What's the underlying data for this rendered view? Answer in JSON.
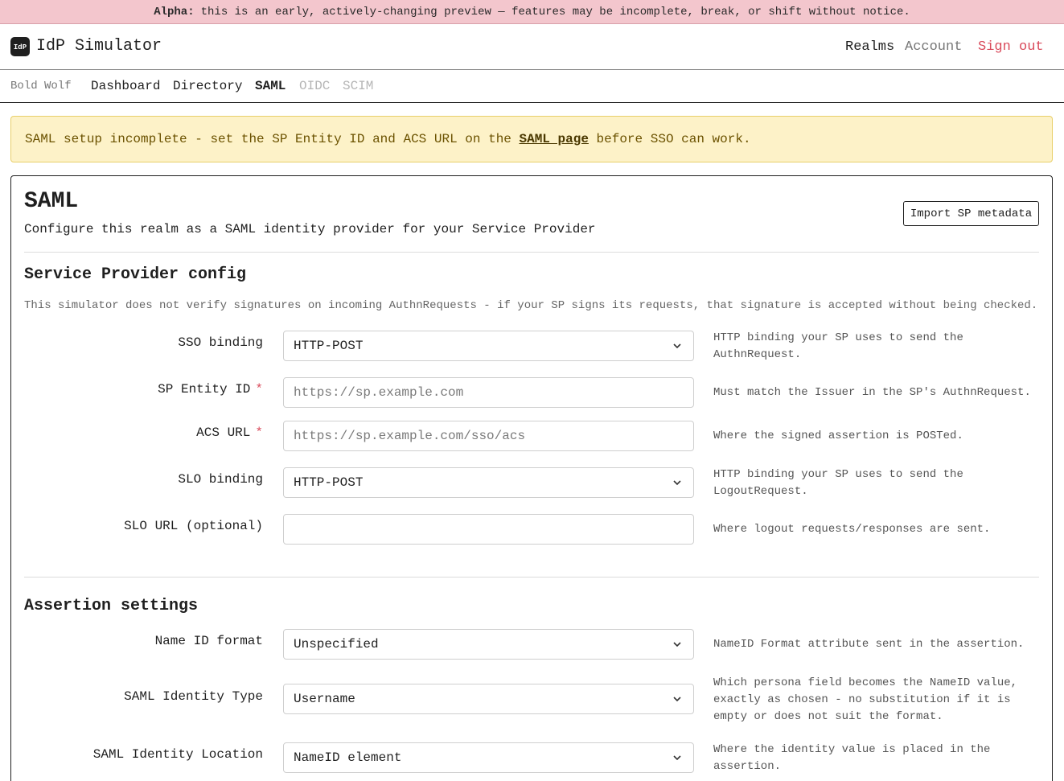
{
  "banner": {
    "strong": "Alpha:",
    "text": "this is an early, actively-changing preview — features may be incomplete, break, or shift without notice."
  },
  "header": {
    "logo_text": "IdP",
    "title": "IdP Simulator",
    "nav": {
      "realms": "Realms",
      "account": "Account",
      "sign_out": "Sign out"
    }
  },
  "subnav": {
    "realm_name": "Bold Wolf",
    "tabs": {
      "dashboard": "Dashboard",
      "directory": "Directory",
      "saml": "SAML",
      "oidc": "OIDC",
      "scim": "SCIM"
    }
  },
  "warning": {
    "before": "SAML setup incomplete - set the SP Entity ID and ACS URL on the ",
    "link": "SAML page",
    "after": " before SSO can work."
  },
  "page": {
    "title": "SAML",
    "subtitle": "Configure this realm as a SAML identity provider for your Service Provider",
    "import_button": "Import SP metadata"
  },
  "sp_config": {
    "title": "Service Provider config",
    "note": "This simulator does not verify signatures on incoming AuthnRequests - if your SP signs its requests, that signature is accepted without being checked.",
    "required_mark": "*",
    "fields": {
      "sso_binding": {
        "label": "SSO binding",
        "value": "HTTP-POST",
        "help": "HTTP binding your SP uses to send the AuthnRequest."
      },
      "sp_entity_id": {
        "label": "SP Entity ID",
        "placeholder": "https://sp.example.com",
        "help": "Must match the Issuer in the SP's AuthnRequest."
      },
      "acs_url": {
        "label": "ACS URL",
        "placeholder": "https://sp.example.com/sso/acs",
        "help": "Where the signed assertion is POSTed."
      },
      "slo_binding": {
        "label": "SLO binding",
        "value": "HTTP-POST",
        "help": "HTTP binding your SP uses to send the LogoutRequest."
      },
      "slo_url": {
        "label": "SLO URL (optional)",
        "value": "",
        "help": "Where logout requests/responses are sent."
      }
    }
  },
  "assertion": {
    "title": "Assertion settings",
    "fields": {
      "name_id_format": {
        "label": "Name ID format",
        "value": "Unspecified",
        "help": "NameID Format attribute sent in the assertion."
      },
      "identity_type": {
        "label": "SAML Identity Type",
        "value": "Username",
        "help": "Which persona field becomes the NameID value, exactly as chosen - no substitution if it is empty or does not suit the format."
      },
      "identity_location": {
        "label": "SAML Identity Location",
        "value": "NameID element",
        "help": "Where the identity value is placed in the assertion."
      }
    }
  }
}
